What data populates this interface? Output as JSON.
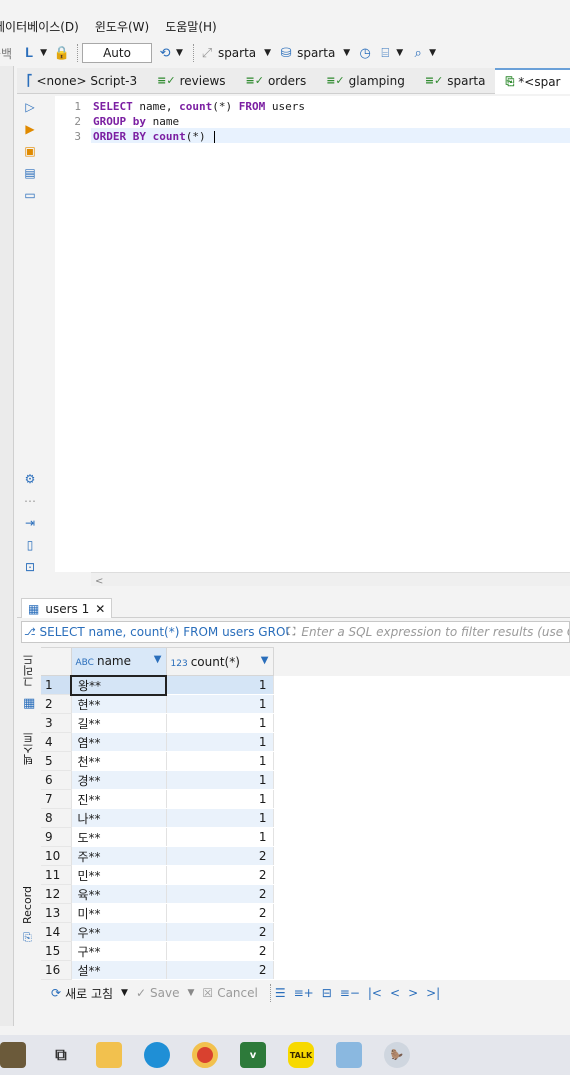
{
  "menu": [
    "데이터베이스(D)",
    "윈도우(W)",
    "도움말(H)"
  ],
  "toolbar": {
    "left_clip": "공백",
    "transaction_mode": "Auto",
    "datasource": "sparta",
    "schema": "sparta"
  },
  "editor_tabs": [
    {
      "label": "<none> Script-3",
      "active": false
    },
    {
      "label": "reviews",
      "active": false
    },
    {
      "label": "orders",
      "active": false
    },
    {
      "label": "glamping",
      "active": false
    },
    {
      "label": "sparta",
      "active": false
    },
    {
      "label": "*<spar",
      "active": true
    }
  ],
  "editor": {
    "line_numbers": [
      "1",
      "2",
      "3"
    ],
    "lines": [
      {
        "tokens": [
          {
            "t": "SELECT",
            "k": 1
          },
          {
            "t": " name, ",
            "k": 0
          },
          {
            "t": "count",
            "k": 1
          },
          {
            "t": "(*) ",
            "k": 0
          },
          {
            "t": "FROM",
            "k": 1
          },
          {
            "t": " users",
            "k": 0
          }
        ]
      },
      {
        "tokens": [
          {
            "t": "GROUP by",
            "k": 1
          },
          {
            "t": " name",
            "k": 0
          }
        ]
      },
      {
        "tokens": [
          {
            "t": "ORDER BY",
            "k": 1
          },
          {
            "t": " ",
            "k": 0
          },
          {
            "t": "count",
            "k": 1
          },
          {
            "t": "(*)",
            "k": 0
          }
        ]
      }
    ]
  },
  "results": {
    "tab_label": "users 1",
    "filter_sql": "SELECT name, count(*) FROM users GROUP b",
    "filter_placeholder": "Enter a SQL expression to filter results (use Ctrl",
    "side_labels": {
      "grid": "그리드",
      "text": "텍스트",
      "record": "Record"
    },
    "columns": [
      {
        "type": "ABC",
        "label": "name"
      },
      {
        "type": "123",
        "label": "count(*)"
      }
    ],
    "rows": [
      {
        "n": "1",
        "name": "왕**",
        "count": "1"
      },
      {
        "n": "2",
        "name": "현**",
        "count": "1"
      },
      {
        "n": "3",
        "name": "길**",
        "count": "1"
      },
      {
        "n": "4",
        "name": "염**",
        "count": "1"
      },
      {
        "n": "5",
        "name": "천**",
        "count": "1"
      },
      {
        "n": "6",
        "name": "경**",
        "count": "1"
      },
      {
        "n": "7",
        "name": "진**",
        "count": "1"
      },
      {
        "n": "8",
        "name": "나**",
        "count": "1"
      },
      {
        "n": "9",
        "name": "도**",
        "count": "1"
      },
      {
        "n": "10",
        "name": "주**",
        "count": "2"
      },
      {
        "n": "11",
        "name": "민**",
        "count": "2"
      },
      {
        "n": "12",
        "name": "육**",
        "count": "2"
      },
      {
        "n": "13",
        "name": "미**",
        "count": "2"
      },
      {
        "n": "14",
        "name": "우**",
        "count": "2"
      },
      {
        "n": "15",
        "name": "구**",
        "count": "2"
      },
      {
        "n": "16",
        "name": "설**",
        "count": "2"
      }
    ]
  },
  "bottom_bar": {
    "refresh": "새로 고침",
    "save": "Save",
    "cancel": "Cancel"
  },
  "taskbar": {
    "v_app": "v",
    "talk_app": "TALK"
  },
  "colors": {
    "keyword": "#7b1fa2",
    "selection": "#d5e5f6",
    "accent": "#2a6ebb"
  }
}
